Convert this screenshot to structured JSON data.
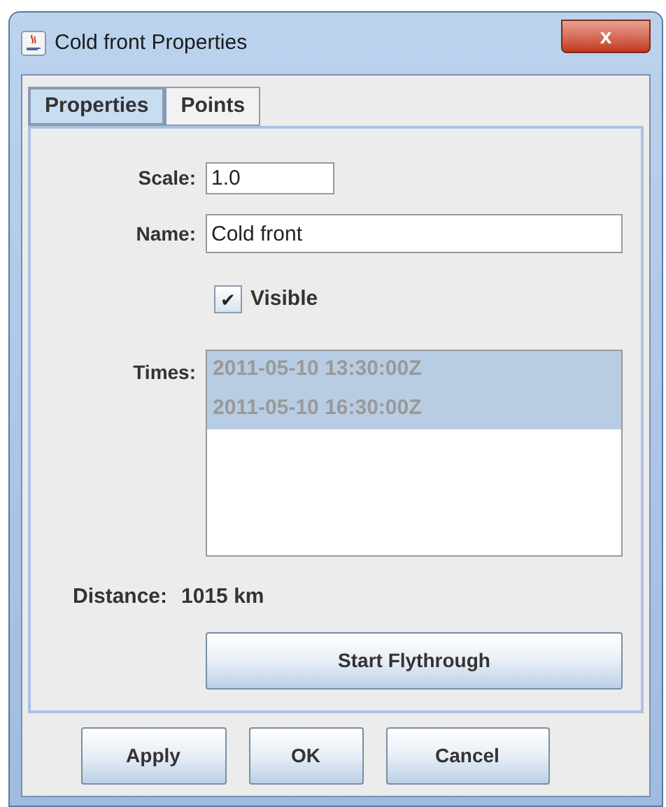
{
  "window": {
    "title": "Cold front Properties",
    "close_label": "x"
  },
  "tabs": [
    {
      "label": "Properties",
      "selected": true
    },
    {
      "label": "Points",
      "selected": false
    }
  ],
  "form": {
    "scale": {
      "label": "Scale:",
      "value": "1.0"
    },
    "name": {
      "label": "Name:",
      "value": "Cold front"
    },
    "visible": {
      "label": "Visible",
      "checked": true,
      "check_mark": "✔"
    },
    "times": {
      "label": "Times:",
      "items": [
        {
          "text": "2011-05-10 13:30:00Z",
          "selected": true
        },
        {
          "text": "2011-05-10 16:30:00Z",
          "selected": true
        }
      ]
    },
    "distance": {
      "label": "Distance:",
      "value": "1015 km"
    },
    "flythrough_button": "Start Flythrough"
  },
  "buttons": [
    "Apply",
    "OK",
    "Cancel"
  ]
}
